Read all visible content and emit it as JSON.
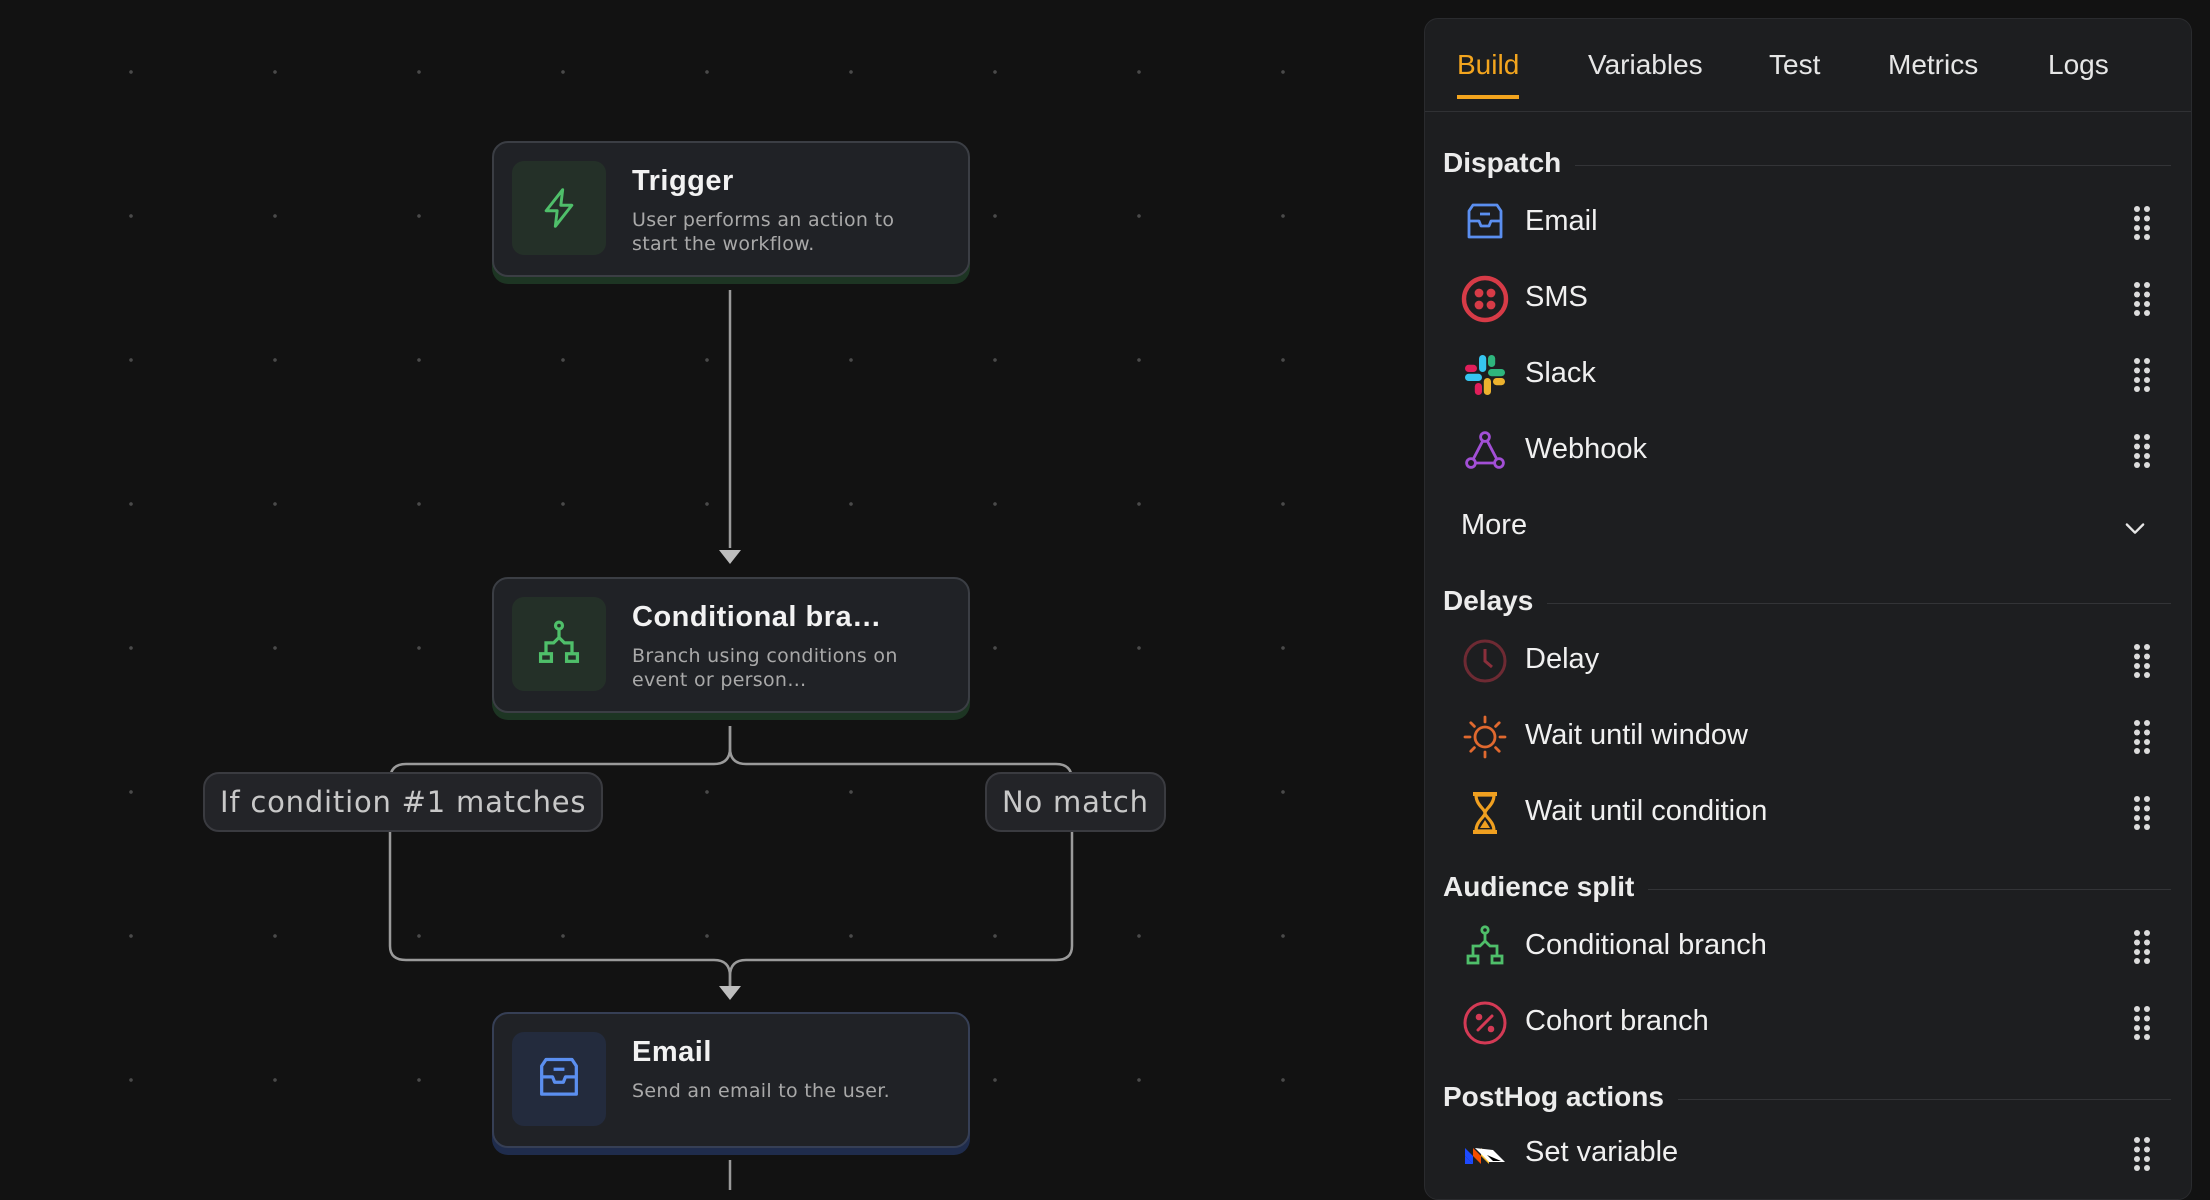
{
  "canvas": {
    "nodes": {
      "trigger": {
        "title": "Trigger",
        "description": "User performs an action to start the workflow.",
        "icon": "lightning-bolt-icon"
      },
      "conditional": {
        "title": "Conditional bra…",
        "description": "Branch using conditions on event or person…",
        "icon": "branch-icon"
      },
      "email": {
        "title": "Email",
        "description": "Send an email to the user.",
        "icon": "inbox-icon"
      }
    },
    "edge_labels": {
      "match": "If condition #1 matches",
      "no_match": "No match"
    }
  },
  "panel": {
    "tabs": [
      {
        "label": "Build",
        "active": true
      },
      {
        "label": "Variables"
      },
      {
        "label": "Test"
      },
      {
        "label": "Metrics"
      },
      {
        "label": "Logs"
      }
    ],
    "sections": {
      "dispatch": {
        "title": "Dispatch",
        "items": [
          {
            "label": "Email",
            "icon": "inbox-icon"
          },
          {
            "label": "SMS",
            "icon": "twilio-icon"
          },
          {
            "label": "Slack",
            "icon": "slack-icon"
          },
          {
            "label": "Webhook",
            "icon": "webhook-icon"
          }
        ],
        "more_label": "More"
      },
      "delays": {
        "title": "Delays",
        "items": [
          {
            "label": "Delay",
            "icon": "clock-icon"
          },
          {
            "label": "Wait until window",
            "icon": "sun-icon"
          },
          {
            "label": "Wait until condition",
            "icon": "hourglass-icon"
          }
        ]
      },
      "audience": {
        "title": "Audience split",
        "items": [
          {
            "label": "Conditional branch",
            "icon": "branch-icon"
          },
          {
            "label": "Cohort branch",
            "icon": "percent-circle-icon"
          }
        ]
      },
      "posthog": {
        "title": "PostHog actions",
        "items": [
          {
            "label": "Set variable",
            "icon": "posthog-icon"
          }
        ]
      }
    }
  },
  "colors": {
    "accent": "#f3a51e",
    "node_green": "#4fbf6a",
    "node_blue": "#5b8ff0",
    "sms_red": "#d73b47",
    "webhook_purple": "#a24fd6",
    "cohort_red": "#d43a55"
  }
}
